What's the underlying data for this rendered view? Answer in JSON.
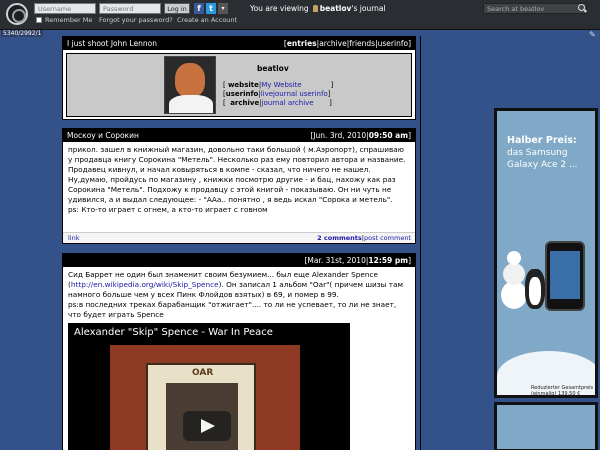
{
  "topbar": {
    "username_placeholder": "Username",
    "password_placeholder": "Password",
    "login_label": "Log in",
    "remember_label": "Remember Me",
    "forgot_label": "Forgot your password?",
    "create_label": "Create an Account",
    "viewing_prefix": "You are viewing",
    "viewing_user": "beatlov",
    "viewing_suffix": "'s journal",
    "search_placeholder": "Search at beatlov",
    "fb_glyph": "f",
    "tw_glyph": "t",
    "dropdown_glyph": "▾"
  },
  "counter": "5340/2992/1",
  "header": {
    "title": "I just shoot John Lennon",
    "nav": [
      "entries",
      "archive",
      "friends",
      "userinfo"
    ],
    "journal_name": "beatlov",
    "rows": [
      {
        "label": "website",
        "value": "My Website"
      },
      {
        "label": "userinfo",
        "value": "livejournal userinfo"
      },
      {
        "label": "archive",
        "value": "journal archive"
      }
    ]
  },
  "posts": [
    {
      "title": "Москоу и Сорокин",
      "date": "[Jun. 3rd, 2010|",
      "time": "09:50 am",
      "date_end": "]",
      "body": "прикол. зашел в книжный магазин, довольно таки большой ( м.Аэропорт), спрашиваю у продавца книгу Сорокина \"Метель\". Несколько раз ему повторил автора и название. Продавец кивнул, и начал ковыряться в компе - сказал, что ничего не нашел. Ну,думаю, пройдусь по магазину , книжки посмотрю другие - и бац, нахожу как раз Сорокина \"Метель\". Подхожу к продавцу с этой книгой - показываю. Он ни чуть не удивился, а и выдал следующее: - \"ААа.. понятно , я ведь искал \"Сорока и метель\".",
      "ps": "ps: Кто-то играет с огнем, а кто-то играет с говном",
      "link_label": "link",
      "comments_label": "2 comments",
      "post_comment_label": "post comment"
    },
    {
      "date": "[Mar. 31st, 2010|",
      "time": "12:59 pm",
      "date_end": "]",
      "body_start": "Сид Баррет не один был знаменит своим безумием... был еще Alexander Spence (",
      "url": "http://en.wikipedia.org/wiki/Skip_Spence",
      "body_end": "). Он записал 1 альбом \"Oar\"( причем шизы там намного больше чем у всех Пинк Флойдов взятых) в 69, и помер в 99.",
      "ps": "ps:в последних треках барабанщик \"отжигает\".... то ли не успевает, то ли не знает, что будет играть Spence",
      "video_title": "Alexander \"Skip\" Spence - War In Peace",
      "album_label": "OAR"
    }
  ],
  "ad": {
    "line1": "Halber Preis:",
    "line2": "das Samsung Galaxy Ace 2 ...",
    "price_note": "Reduzierter Gesamtpreis (einmalig) 139,50 €"
  },
  "colors": {
    "background": "#34528a",
    "topbar": "#2a2e33",
    "link": "#1a1aa8"
  },
  "icons": [
    "livejournal-logo-icon",
    "facebook-icon",
    "twitter-icon",
    "search-icon",
    "user-icon",
    "pencil-icon",
    "play-icon"
  ]
}
